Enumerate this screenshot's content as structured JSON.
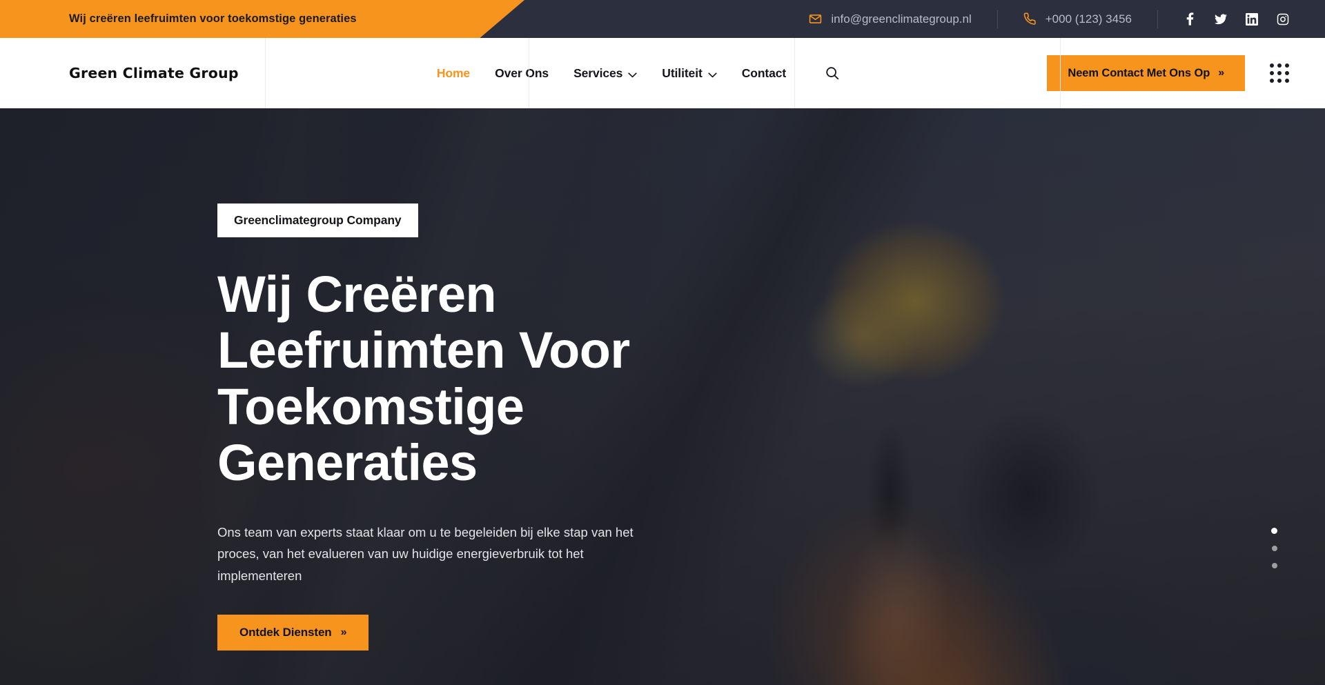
{
  "topbar": {
    "tagline": "Wij creëren leefruimten voor toekomstige generaties",
    "email": "info@greenclimategroup.nl",
    "phone": "+000 (123) 3456",
    "email_icon": "envelope-icon",
    "phone_icon": "phone-icon",
    "socials": [
      {
        "name": "facebook-icon",
        "label": "f"
      },
      {
        "name": "twitter-icon",
        "label": "t"
      },
      {
        "name": "linkedin-icon",
        "label": "in"
      },
      {
        "name": "instagram-icon",
        "label": "ig"
      }
    ]
  },
  "header": {
    "logo": "Green Climate Group",
    "nav": [
      {
        "label": "Home",
        "active": true,
        "caret": false
      },
      {
        "label": "Over Ons",
        "active": false,
        "caret": false
      },
      {
        "label": "Services",
        "active": false,
        "caret": true
      },
      {
        "label": "Utiliteit",
        "active": false,
        "caret": true
      },
      {
        "label": "Contact",
        "active": false,
        "caret": false
      }
    ],
    "nav_caret": "⌄",
    "search_icon": "search-icon",
    "cta_label": "Neem Contact Met Ons Op",
    "cta_chevron": "»",
    "grid_icon": "grid-dots-icon"
  },
  "hero": {
    "badge": "Greenclimategroup Company",
    "title": "Wij Creëren Leefruimten Voor Toekomstige Generaties",
    "subtitle": "Ons team van experts staat klaar om u te begeleiden bij elke stap van het proces, van het evalueren van uw huidige energieverbruik tot het implementeren",
    "cta_label": "Ontdek Diensten",
    "cta_chevron": "»",
    "slides": [
      {
        "index": 1,
        "active": true
      },
      {
        "index": 2,
        "active": false
      },
      {
        "index": 3,
        "active": false
      }
    ]
  },
  "colors": {
    "accent": "#f7941e",
    "dark": "#2b2f3e",
    "text_dark": "#14161c",
    "white": "#ffffff"
  }
}
